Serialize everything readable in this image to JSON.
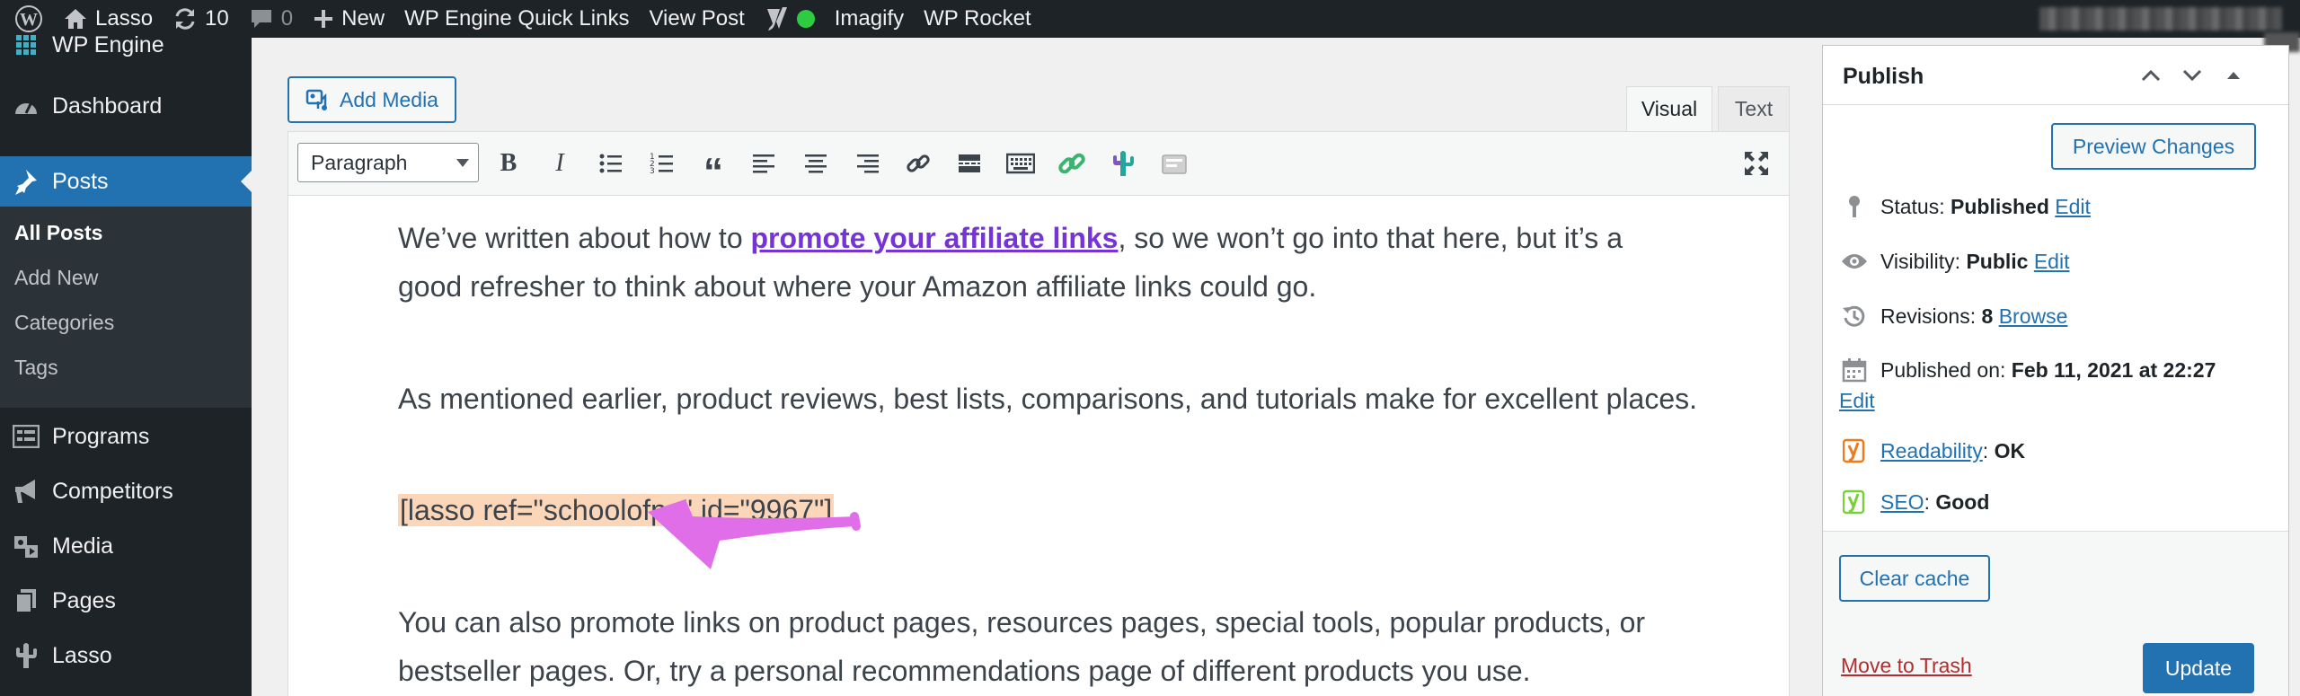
{
  "admin_bar": {
    "site_name": "Lasso",
    "updates_count": "10",
    "comments_count": "0",
    "new_label": "New",
    "quick_links_label": "WP Engine Quick Links",
    "view_post_label": "View Post",
    "imagify_label": "Imagify",
    "wp_rocket_label": "WP Rocket"
  },
  "sidebar": {
    "items": [
      {
        "label": "WP Engine",
        "icon": "grid-icon"
      },
      {
        "label": "Dashboard",
        "icon": "dashboard-icon"
      },
      {
        "label": "Posts",
        "icon": "pin-icon"
      },
      {
        "label": "Programs",
        "icon": "list-icon"
      },
      {
        "label": "Competitors",
        "icon": "megaphone-icon"
      },
      {
        "label": "Media",
        "icon": "media-icon"
      },
      {
        "label": "Pages",
        "icon": "pages-icon"
      },
      {
        "label": "Lasso",
        "icon": "cactus-icon"
      }
    ],
    "submenu": [
      "All Posts",
      "Add New",
      "Categories",
      "Tags"
    ]
  },
  "editor": {
    "add_media_label": "Add Media",
    "tabs": [
      "Visual",
      "Text"
    ],
    "format_select": "Paragraph",
    "content": {
      "p1_before": "We’ve written about how to ",
      "p1_link": "promote your affiliate links",
      "p1_after": ", so we won’t go into that here, but it’s a",
      "p1_line2": "good refresher to think about where your Amazon affiliate links could go.",
      "p2": "As mentioned earlier, product reviews, best lists, comparisons, and tutorials make for excellent places.",
      "shortcode": "[lasso ref=\"schoolofpe\" id=\"9967\"]",
      "p3_line1": "You can also promote links on product pages, resources pages, special tools, popular products, or",
      "p3_line2": "bestseller pages. Or, try a personal recommendations page of different products you use."
    }
  },
  "publish": {
    "title": "Publish",
    "preview_label": "Preview Changes",
    "status_label": "Status:",
    "status_value": "Published",
    "visibility_label": "Visibility:",
    "visibility_value": "Public",
    "revisions_label": "Revisions:",
    "revisions_value": "8",
    "browse_label": "Browse",
    "published_on_label": "Published on:",
    "published_on_value": "Feb 11, 2021 at 22:27",
    "edit_label": "Edit",
    "readability_label": "Readability",
    "readability_value": "OK",
    "seo_label": "SEO",
    "seo_value": "Good",
    "clear_cache_label": "Clear cache",
    "trash_label": "Move to Trash",
    "update_label": "Update"
  },
  "colors": {
    "admin_bar": "#1d2327",
    "accent": "#2271b1",
    "link_purple": "#7633d8",
    "shortcode_highlight": "#fcd6b8",
    "arrow": "#e06ee8",
    "trash": "#b32d2e"
  }
}
